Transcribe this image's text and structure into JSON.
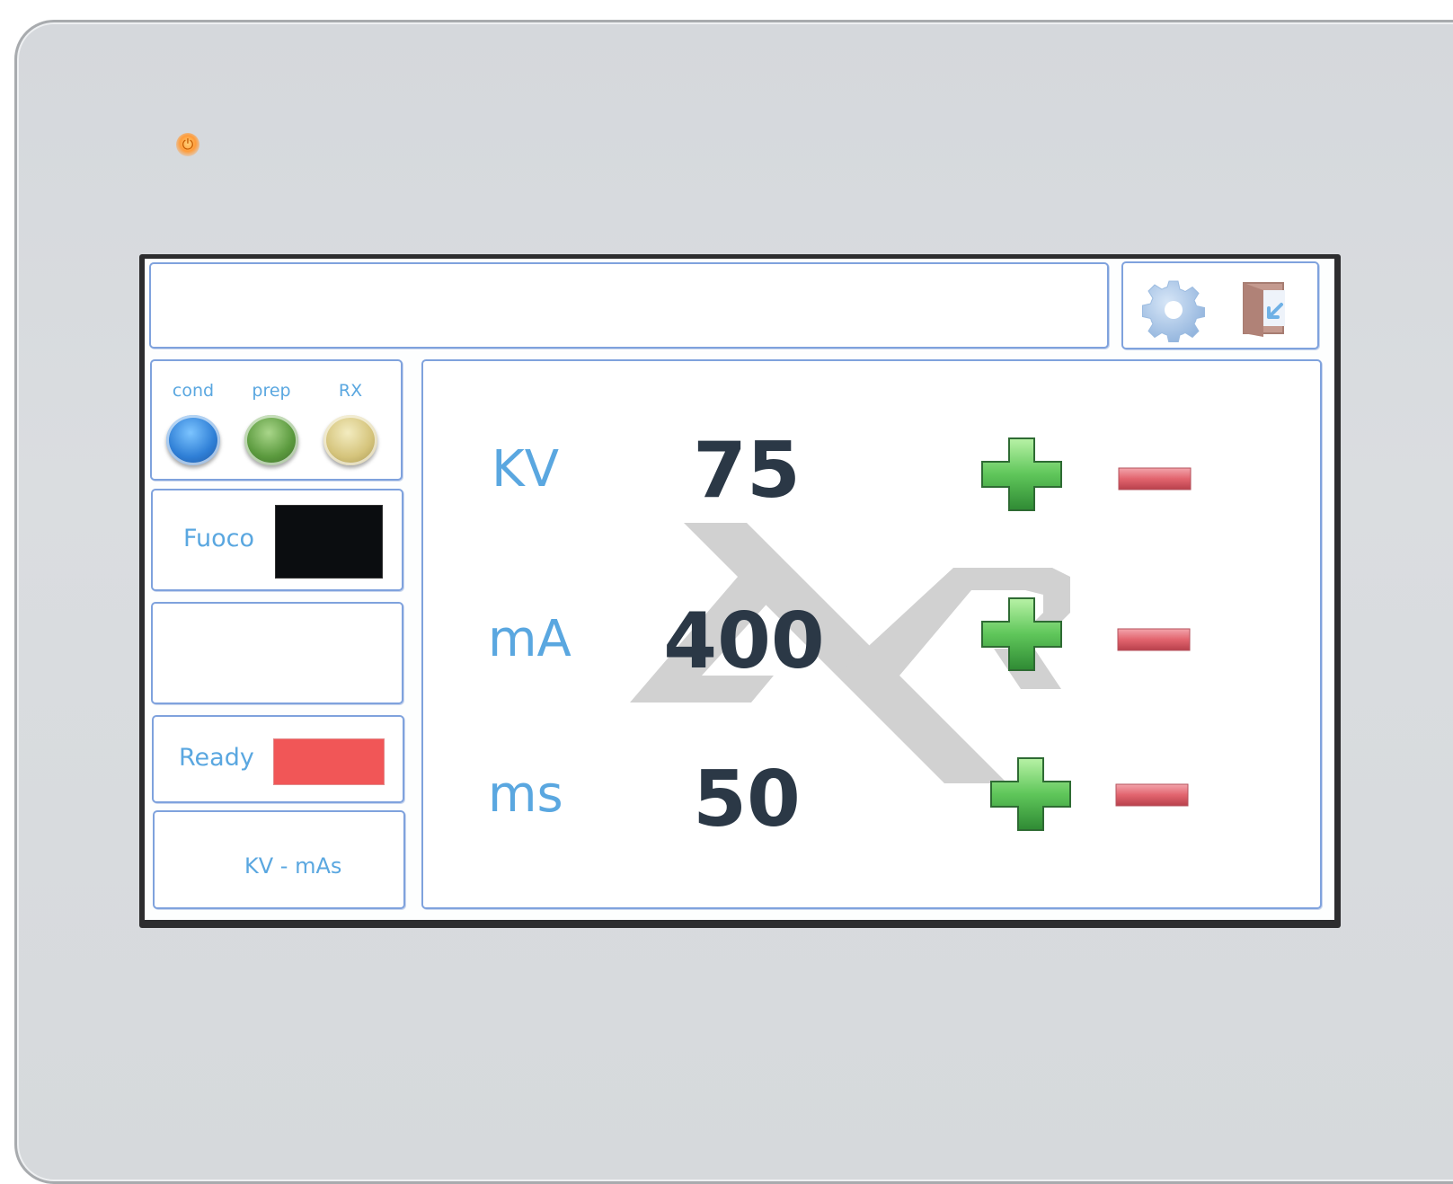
{
  "device": {
    "power_led_icon": "power-led-icon"
  },
  "toolbar": {
    "settings_icon": "gear-icon",
    "exit_icon": "exit-door-icon"
  },
  "status_lamps": [
    {
      "label": "cond",
      "color": "#2f7fd6"
    },
    {
      "label": "prep",
      "color": "#5b9a3e"
    },
    {
      "label": "RX",
      "color": "#d5c47c"
    }
  ],
  "fuoco": {
    "label": "Fuoco",
    "indicator_color": "#0b0d10"
  },
  "ready": {
    "label": "Ready",
    "indicator_color": "#f15657"
  },
  "mode": {
    "label": "KV - mAs"
  },
  "parameters": [
    {
      "label": "KV",
      "value": "75"
    },
    {
      "label": "mA",
      "value": "400"
    },
    {
      "label": "ms",
      "value": "50"
    }
  ],
  "colors": {
    "accent_blue": "#5aa7e0",
    "panel_border": "#7fa2dd",
    "plus_green": "#5fc65a",
    "minus_red": "#e2646e",
    "value_dark": "#2b3846"
  }
}
